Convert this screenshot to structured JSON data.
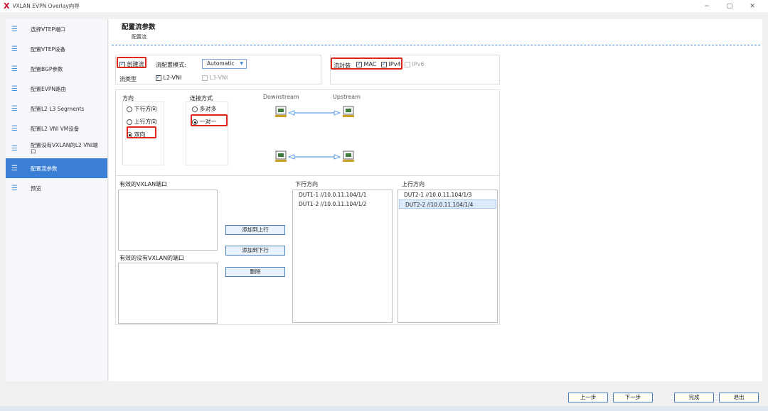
{
  "window": {
    "logo": "X",
    "title": "VXLAN EVPN Overlay向导",
    "controls": [
      "−",
      "▢",
      "✕"
    ]
  },
  "sidebar": {
    "items": [
      {
        "label": "选择VTEP端口",
        "icon": "list-icon"
      },
      {
        "label": "配置VTEP设备",
        "icon": "list-icon"
      },
      {
        "label": "配置BGP参数",
        "icon": "list-icon"
      },
      {
        "label": "配置EVPN路由",
        "icon": "list-icon"
      },
      {
        "label": "配置L2 L3 Segments",
        "icon": "list-icon"
      },
      {
        "label": "配置L2 VNI VM设备",
        "icon": "list-icon"
      },
      {
        "label": "配置没有VXLAN的L2 VNI端口",
        "icon": "list-icon"
      },
      {
        "label": "配置流参数",
        "icon": "list-icon",
        "active": true
      },
      {
        "label": "预览",
        "icon": "list-icon"
      }
    ],
    "icon_glyph": "☰"
  },
  "header": {
    "title": "配置流参数",
    "subtitle": "配置流"
  },
  "flow_config": {
    "create_flow_label": "创建流",
    "create_flow_checked": true,
    "mode_label": "流配置模式:",
    "mode_value": "Automatic",
    "type_label": "流类型",
    "l2vni_label": "L2-VNI",
    "l2vni_checked": true,
    "l3vni_label": "L3-VNI",
    "l3vni_checked": false
  },
  "encap": {
    "label": "流封装",
    "mac_label": "MAC",
    "mac_checked": true,
    "ipv4_label": "IPv4",
    "ipv4_checked": true,
    "ipv6_label": "IPv6",
    "ipv6_checked": false
  },
  "direction": {
    "label": "方向",
    "options": [
      "下行方向",
      "上行方向",
      "双向"
    ],
    "selected": "双向"
  },
  "connection": {
    "label": "连接方式",
    "options": [
      "多对多",
      "一对一"
    ],
    "selected": "一对一"
  },
  "diagram": {
    "downstream_label": "Downstream",
    "upstream_label": "Upstream"
  },
  "ports": {
    "valid_vxlan_label": "有效的VXLAN端口",
    "valid_vxlan_items": [],
    "valid_non_vxlan_label": "有效的没有VXLAN的端口",
    "valid_non_vxlan_items": [],
    "add_upstream_button": "添加到上行",
    "add_downstream_button": "添加到下行",
    "delete_button": "删除",
    "downstream_label": "下行方向",
    "downstream_items": [
      "DUT1-1 //10.0.11.104/1/1",
      "DUT1-2 //10.0.11.104/1/2"
    ],
    "upstream_label": "上行方向",
    "upstream_items": [
      "DUT2-1 //10.0.11.104/1/3",
      "DUT2-2 //10.0.11.104/1/4"
    ],
    "upstream_selected_index": 1
  },
  "footer": {
    "prev": "上一步",
    "next": "下一步",
    "finish": "完成",
    "exit": "退出"
  },
  "colors": {
    "accent": "#3a7fd5",
    "highlight_box": "#e0261c",
    "arrow": "#3a8ee6"
  }
}
